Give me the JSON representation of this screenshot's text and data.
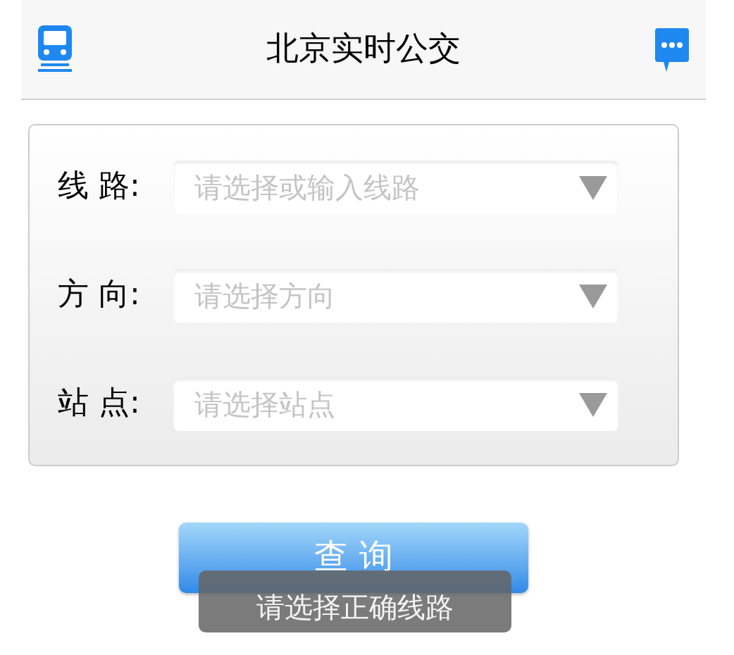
{
  "header": {
    "title": "北京实时公交"
  },
  "fields": [
    {
      "label": "线 路:",
      "placeholder": "请选择或输入线路"
    },
    {
      "label": "方 向:",
      "placeholder": "请选择方向"
    },
    {
      "label": "站 点:",
      "placeholder": "请选择站点"
    }
  ],
  "query_button": {
    "label": "查 询"
  },
  "toast": {
    "message": "请选择正确线路"
  }
}
